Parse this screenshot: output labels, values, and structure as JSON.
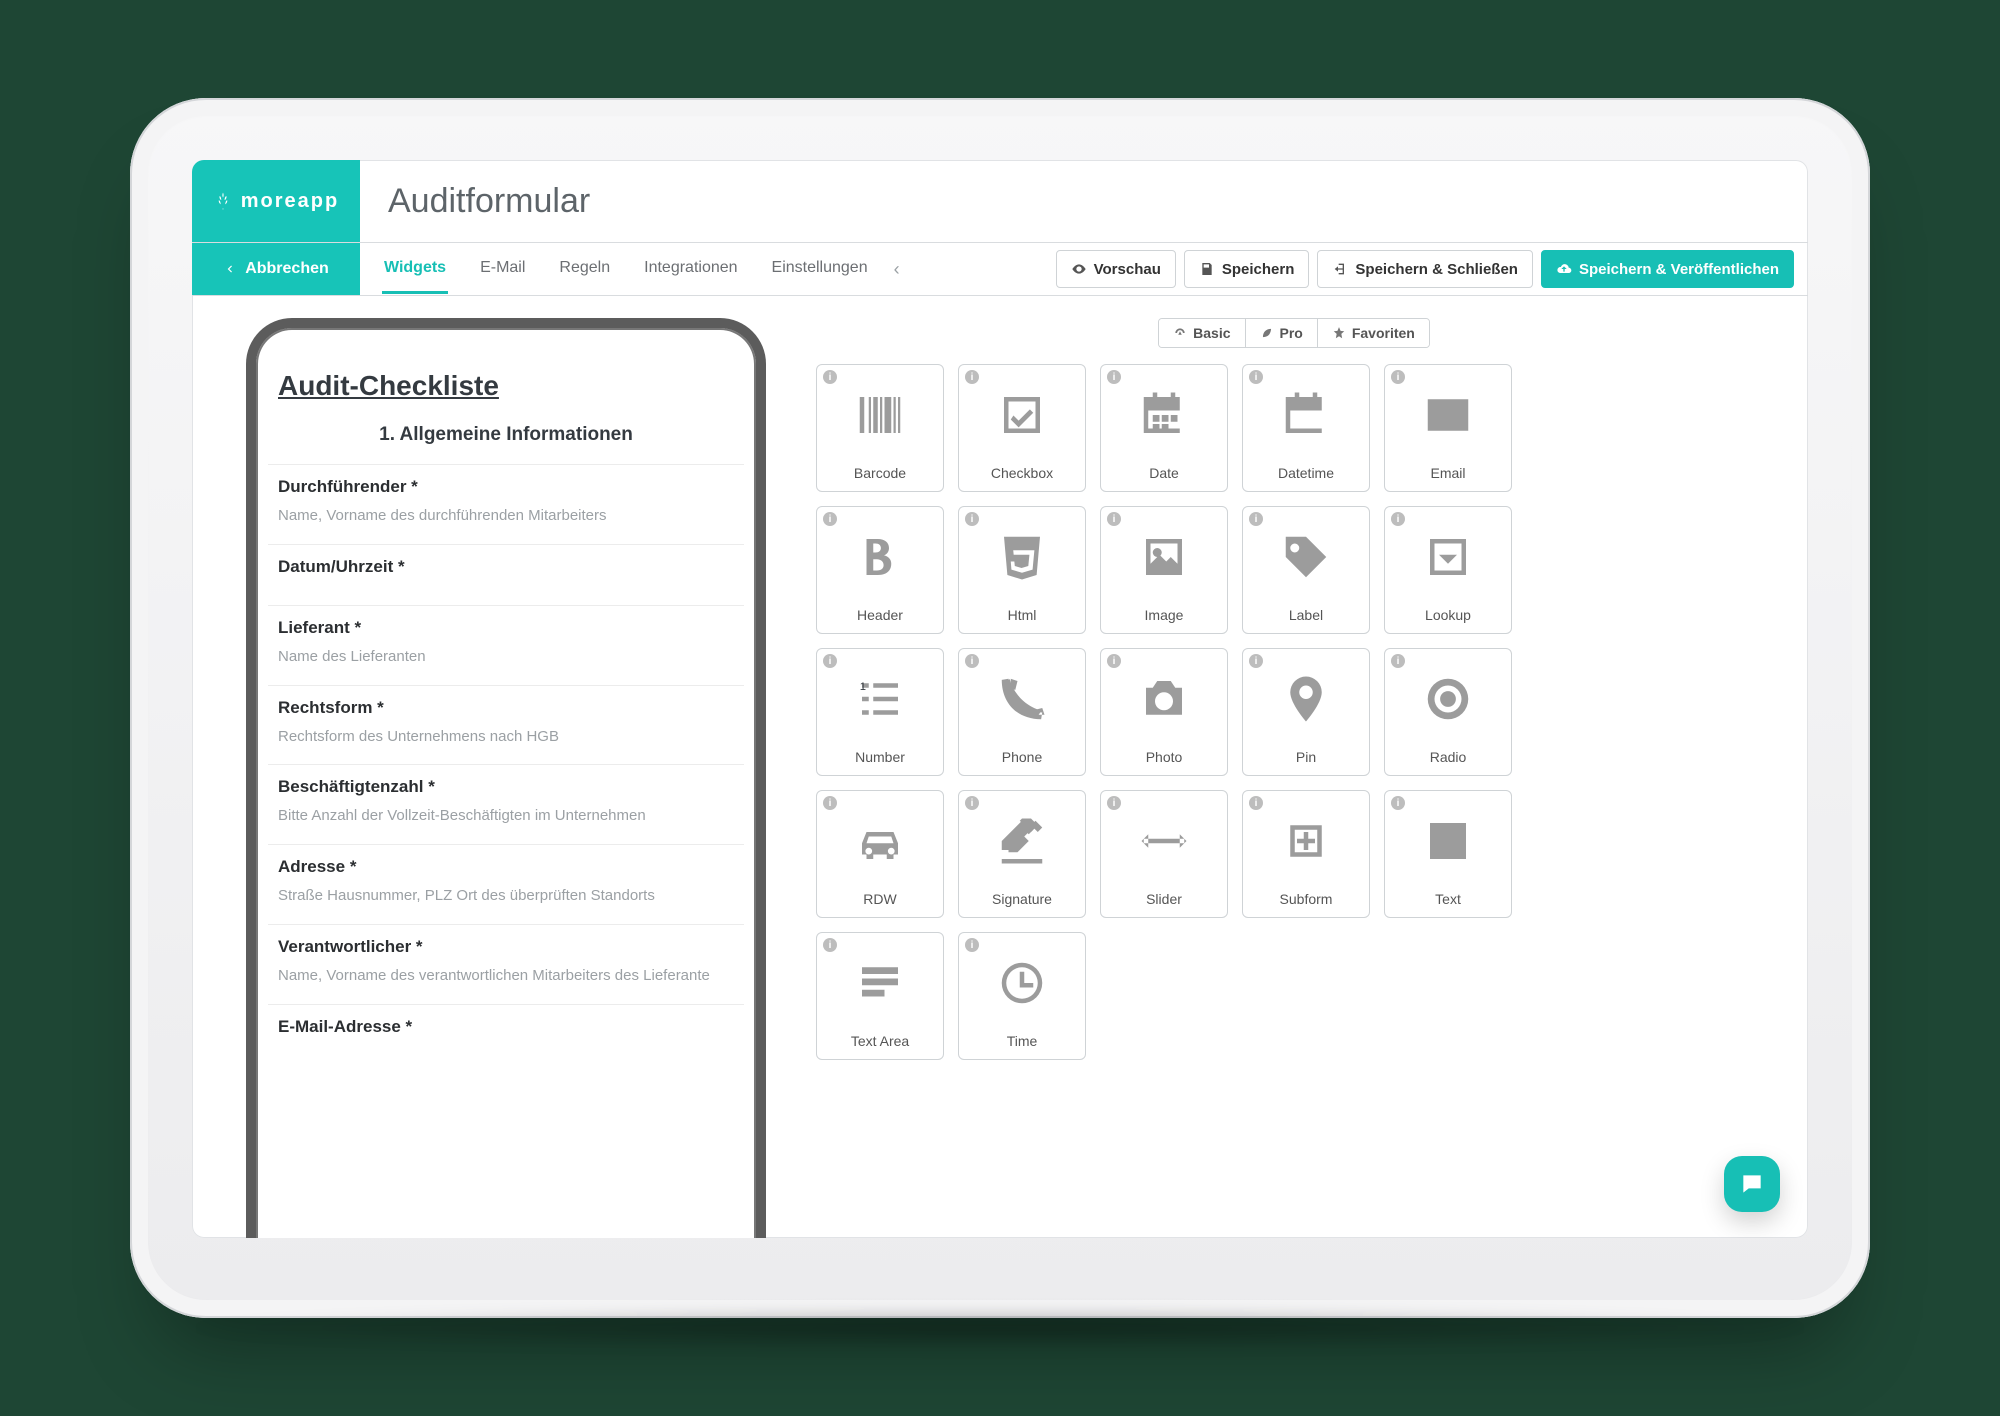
{
  "brand": {
    "name": "moreapp"
  },
  "page_title": "Auditformular",
  "cancel_label": "Abbrechen",
  "tabs": {
    "items": [
      {
        "label": "Widgets",
        "active": true
      },
      {
        "label": "E-Mail"
      },
      {
        "label": "Regeln"
      },
      {
        "label": "Integrationen"
      },
      {
        "label": "Einstellungen"
      }
    ],
    "overflow_glyph": "‹"
  },
  "actions": {
    "preview": "Vorschau",
    "save": "Speichern",
    "save_close": "Speichern & Schließen",
    "save_publish": "Speichern & Veröffentlichen"
  },
  "segmented": {
    "basic": "Basic",
    "pro": "Pro",
    "favorites": "Favoriten"
  },
  "form": {
    "title": "Audit-Checkliste",
    "section": "1. Allgemeine Informationen",
    "fields": [
      {
        "label": "Durchführender *",
        "hint": "Name, Vorname des durchführenden Mitarbeiters"
      },
      {
        "label": "Datum/Uhrzeit *",
        "hint": ""
      },
      {
        "label": "Lieferant *",
        "hint": "Name des Lieferanten"
      },
      {
        "label": "Rechtsform *",
        "hint": "Rechtsform des Unternehmens nach HGB"
      },
      {
        "label": "Beschäftigtenzahl *",
        "hint": "Bitte Anzahl der Vollzeit-Beschäftigten im Unternehmen"
      },
      {
        "label": "Adresse *",
        "hint": "Straße Hausnummer, PLZ Ort des überprüften Standorts"
      },
      {
        "label": "Verantwortlicher *",
        "hint": "Name, Vorname des verantwortlichen Mitarbeiters des Lieferante"
      },
      {
        "label": "E-Mail-Adresse *",
        "hint": ""
      }
    ]
  },
  "widgets": [
    {
      "label": "Barcode",
      "key": "barcode"
    },
    {
      "label": "Checkbox",
      "key": "checkbox"
    },
    {
      "label": "Date",
      "key": "date"
    },
    {
      "label": "Datetime",
      "key": "datetime"
    },
    {
      "label": "Email",
      "key": "email"
    },
    {
      "label": "Header",
      "key": "header"
    },
    {
      "label": "Html",
      "key": "html"
    },
    {
      "label": "Image",
      "key": "image"
    },
    {
      "label": "Label",
      "key": "label"
    },
    {
      "label": "Lookup",
      "key": "lookup"
    },
    {
      "label": "Number",
      "key": "number"
    },
    {
      "label": "Phone",
      "key": "phone"
    },
    {
      "label": "Photo",
      "key": "photo"
    },
    {
      "label": "Pin",
      "key": "pin"
    },
    {
      "label": "Radio",
      "key": "radio"
    },
    {
      "label": "RDW",
      "key": "rdw"
    },
    {
      "label": "Signature",
      "key": "signature"
    },
    {
      "label": "Slider",
      "key": "slider"
    },
    {
      "label": "Subform",
      "key": "subform"
    },
    {
      "label": "Text",
      "key": "text"
    },
    {
      "label": "Text Area",
      "key": "textarea"
    },
    {
      "label": "Time",
      "key": "time"
    }
  ],
  "chat_hint": "Chat"
}
